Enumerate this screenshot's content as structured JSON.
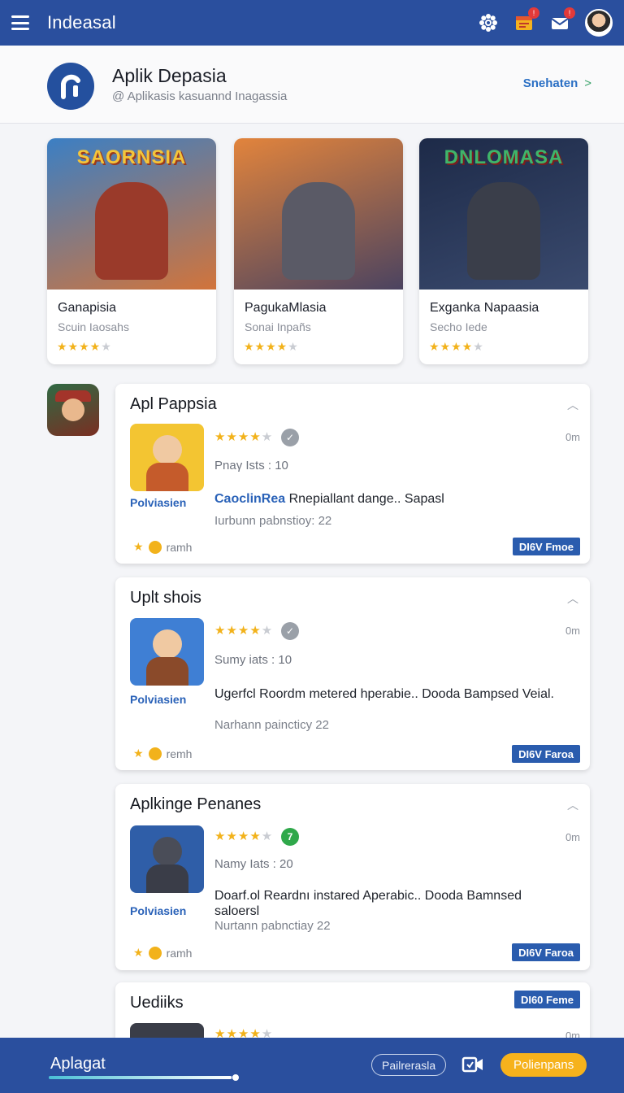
{
  "topbar": {
    "title": "Indeasal",
    "notifications": [
      {
        "icon": "gear-icon",
        "badge": ""
      },
      {
        "icon": "calendar-icon",
        "badge": "!"
      },
      {
        "icon": "mail-icon",
        "badge": "!"
      }
    ]
  },
  "header": {
    "app_name": "Aplik Depasia",
    "subtitle": "@ Aplikasis kasuannd Inagassia",
    "link_label": "Snehaten",
    "link_chevron": ">"
  },
  "featured": [
    {
      "art_title": "SAORNSIA",
      "name": "Ganapisia",
      "sub": "Scuin Iaosahs",
      "stars": 4,
      "colors": {
        "bg1": "#3b7fc4",
        "bg2": "#d2743b",
        "title": "#f4c53a",
        "figure": "#9a3a2a"
      }
    },
    {
      "art_title": "",
      "name": "PagukaMlasia",
      "sub": "Sonai Inpañs",
      "stars": 4,
      "colors": {
        "bg1": "#e2843c",
        "bg2": "#4b4360",
        "title": "#ffffff",
        "figure": "#5a5a66"
      }
    },
    {
      "art_title": "DNLOMASA",
      "name": "Exganka Napaasia",
      "sub": "Secho Iede",
      "stars": 4,
      "colors": {
        "bg1": "#1d2a48",
        "bg2": "#3a4a6e",
        "title": "#3fb56a",
        "figure": "#3a3e4a"
      }
    }
  ],
  "list": [
    {
      "title": "Apl Pappsia",
      "developer": "Polviasien",
      "stars": 4,
      "rating_badge": "✓",
      "badge_color": "#9aa0a8",
      "time": "0m",
      "meta": "Pnaγ Ists : 10",
      "desc_highlight": "CaoclinRea",
      "desc": "Rnepiallant dange.. Sapasl",
      "sub": "Iurbunn pabnstioy: 22",
      "footer": "ramh",
      "cta": "DI6V Fmoe",
      "tile_bg": "#f3c532",
      "tile_body": "#c55b2b"
    },
    {
      "title": "Uplt shois",
      "developer": "Polviasien",
      "stars": 4,
      "rating_badge": "✓",
      "badge_color": "#9aa0a8",
      "time": "0m",
      "meta": "Sumy iats : 10",
      "desc_highlight": "",
      "desc": "Ugerfcl Roordm metered hperabie.. Dooda Bampsed Veial.",
      "sub": "Narhann paincticy 22",
      "footer": "remh",
      "cta": "DI6V Faroa",
      "tile_bg": "#3f7fd4",
      "tile_body": "#8a4a2a"
    },
    {
      "title": "Aplkinge Penanes",
      "developer": "Polviasien",
      "stars": 4,
      "rating_badge": "7",
      "badge_color": "#2fa84a",
      "time": "0m",
      "meta": "Namy Iats : 20",
      "desc_highlight": "",
      "desc": "Doarf.ol Reardnı instared Aperabic.. Dooda Bamnsed saloersl",
      "sub": "Nurtann pabnctiay 22",
      "footer": "ramh",
      "cta": "DI6V Faroa",
      "tile_bg": "#2f5ea8",
      "tile_body": "#3a3d48"
    },
    {
      "title": "Uediiks",
      "developer": "",
      "stars": 4,
      "rating_badge": "",
      "badge_color": "#9aa0a8",
      "time": "0m",
      "meta": "",
      "desc_highlight": "",
      "desc": "",
      "sub": "",
      "footer": "",
      "cta": "DI60 Feme",
      "tile_bg": "#3a3d48",
      "tile_body": "#2b2d33"
    }
  ],
  "bottombar": {
    "label": "Aplagat",
    "progress": 0.98,
    "outline_button": "Pailrerasla",
    "primary_button": "Polienpans"
  },
  "colors": {
    "primary": "#2a4f9e",
    "accent": "#f6b21c",
    "link": "#2a6fc4"
  }
}
